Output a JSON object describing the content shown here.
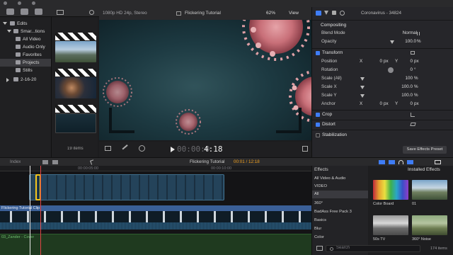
{
  "colors": {
    "accent": "#3f7df6",
    "selection_yellow": "#f5c518",
    "playhead": "#e04545",
    "timecode_active": "#f0a020"
  },
  "library": {
    "items": [
      {
        "label": "Edits",
        "icon": "library-icon"
      },
      {
        "label": "Smar...tions",
        "icon": "folder-icon"
      },
      {
        "label": "All Video",
        "icon": "smart-collection-icon"
      },
      {
        "label": "Audio Only",
        "icon": "smart-collection-icon"
      },
      {
        "label": "Favorites",
        "icon": "smart-collection-icon"
      },
      {
        "label": "Projects",
        "icon": "smart-collection-icon"
      },
      {
        "label": "Stills",
        "icon": "smart-collection-icon"
      },
      {
        "label": "2-16-20",
        "icon": "event-star-icon"
      }
    ]
  },
  "browser": {
    "count": "19 items"
  },
  "viewer": {
    "format": "1080p HD 24p, Stereo",
    "title": "Flickering Tutorial",
    "zoom": "62%",
    "view_label": "View",
    "timecode_dim": "00:00:0",
    "timecode_main": "4:18"
  },
  "inspector": {
    "clip_name": "Coronavirus - 34824",
    "compositing": "Compositing",
    "blend_mode_label": "Blend Mode",
    "blend_mode_value": "Normal",
    "opacity_label": "Opacity",
    "opacity_value": "100.0",
    "opacity_unit": "%",
    "transform": "Transform",
    "position_label": "Position",
    "position_x_axis": "X",
    "position_x": "0",
    "position_x_unit": "px",
    "position_y_axis": "Y",
    "position_y": "0",
    "position_y_unit": "px",
    "rotation_label": "Rotation",
    "rotation_value": "0",
    "rotation_unit": "°",
    "scale_all_label": "Scale (All)",
    "scale_all_value": "100",
    "scale_all_unit": "%",
    "scale_x_label": "Scale X",
    "scale_x_value": "100.0",
    "scale_x_unit": "%",
    "scale_y_label": "Scale Y",
    "scale_y_value": "100.0",
    "scale_y_unit": "%",
    "anchor_label": "Anchor",
    "anchor_x_axis": "X",
    "anchor_x": "0",
    "anchor_x_unit": "px",
    "anchor_y_axis": "Y",
    "anchor_y": "0",
    "anchor_y_unit": "px",
    "crop": "Crop",
    "distort": "Distort",
    "stabilization": "Stabilization",
    "save_preset": "Save Effects Preset"
  },
  "timeline": {
    "index_label": "Index",
    "project_title": "Flickering Tutorial",
    "position": "00:01 / 12:18",
    "ruler": [
      "00:00:05:00",
      "00:00:10:00"
    ],
    "clip_label": "Flickering Tutorial Clip",
    "audio_label": "03_Zander - Cover"
  },
  "effects": {
    "header": "Effects",
    "installed_label": "Installed Effects",
    "categories": [
      "All Video & Audio",
      "VIDEO",
      "All",
      "360°",
      "BadAss Free Pack 3",
      "Basics",
      "Blur",
      "Color"
    ],
    "items": [
      {
        "label": "Color Board"
      },
      {
        "label": "01"
      },
      {
        "label": "50s TV"
      },
      {
        "label": "360° Noise"
      }
    ],
    "search_placeholder": "Search",
    "count": "174 items"
  }
}
